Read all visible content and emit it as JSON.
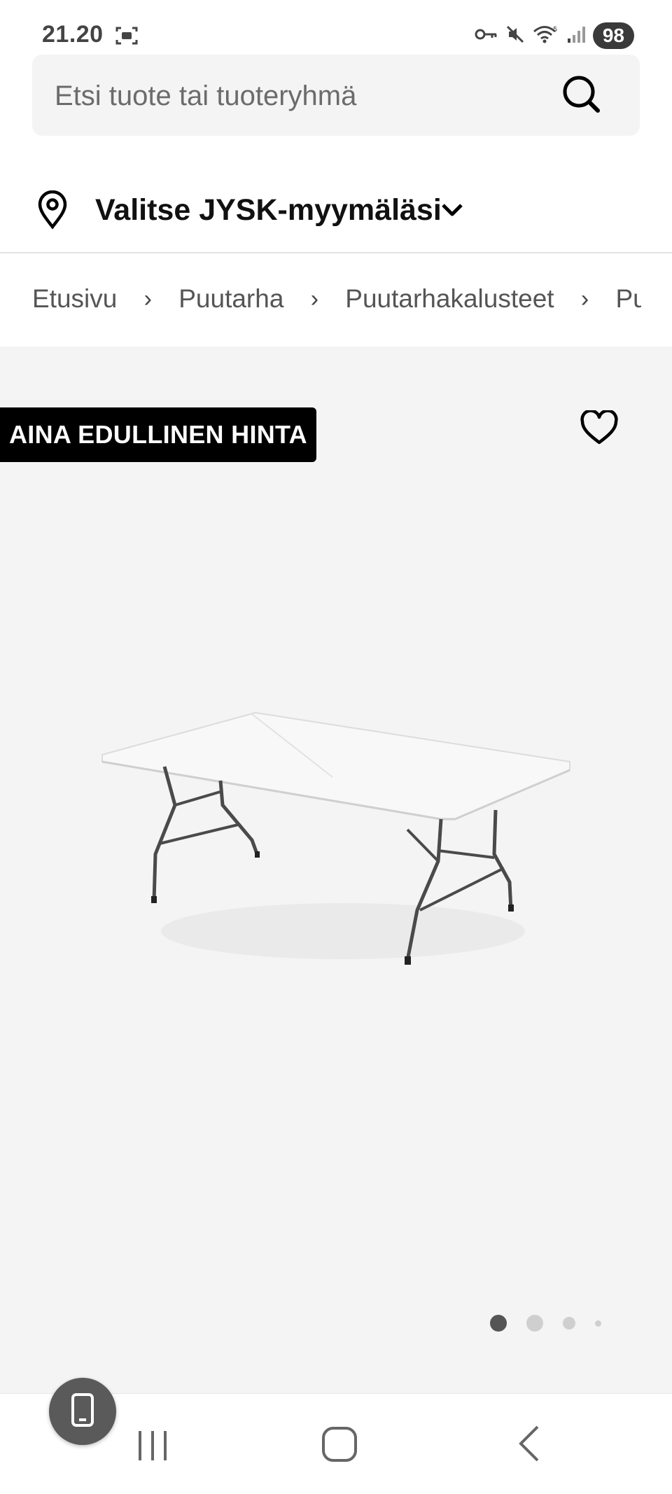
{
  "status_bar": {
    "time": "21.20",
    "battery": "98",
    "icons": [
      "screenshot-icon",
      "key-icon",
      "mute-icon",
      "wifi-icon",
      "signal-icon"
    ]
  },
  "search": {
    "placeholder": "Etsi tuote tai tuoteryhmä",
    "icon": "search-icon"
  },
  "store_selector": {
    "label": "Valitse JYSK-myymäläsi",
    "icon": "location-pin-icon"
  },
  "breadcrumb": {
    "items": [
      "Etusivu",
      "Puutarha",
      "Puutarhakalusteet",
      "Puutarhapöydät"
    ],
    "separator": "›"
  },
  "product": {
    "badge": "AINA EDULLINEN HINTA",
    "favorite_icon": "heart-icon",
    "image_icon": "folding-table-image",
    "gallery_dots_total": 4,
    "gallery_active_index": 0
  },
  "colors": {
    "badge_bg": "#000000",
    "product_bg": "#f4f4f4",
    "search_bg": "#f4f4f4"
  }
}
